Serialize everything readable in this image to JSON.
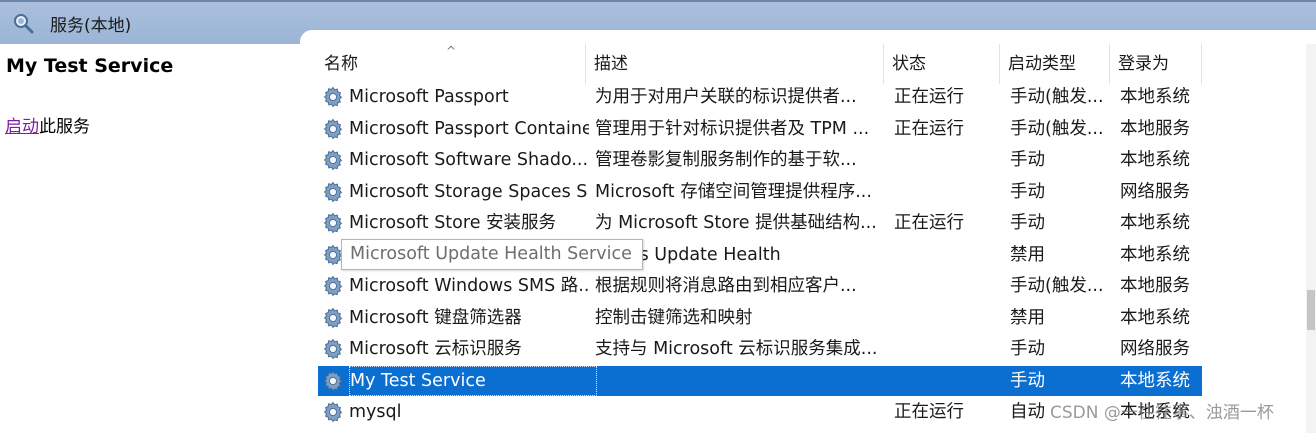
{
  "window": {
    "title": "服务(本地)",
    "icon": "services-magnifier-icon"
  },
  "left_pane": {
    "service_name": "My Test Service",
    "action_link": "启动",
    "action_suffix": "此服务"
  },
  "columns": {
    "name": "名称",
    "description": "描述",
    "status": "状态",
    "startup_type": "启动类型",
    "logon_as": "登录为",
    "sorted_column": "名称",
    "sort_direction": "ascending"
  },
  "rows": [
    {
      "name": "Microsoft Passport",
      "description": "为用于对用户关联的标识提供者...",
      "status": "正在运行",
      "startup_type": "手动(触发...",
      "logon_as": "本地系统"
    },
    {
      "name": "Microsoft Passport Container",
      "description": "管理用于针对标识提供者及 TPM ...",
      "status": "正在运行",
      "startup_type": "手动(触发...",
      "logon_as": "本地服务"
    },
    {
      "name": "Microsoft Software Shado...",
      "description": "管理卷影复制服务制作的基于软...",
      "status": "",
      "startup_type": "手动",
      "logon_as": "本地系统"
    },
    {
      "name": "Microsoft Storage Spaces S...",
      "description": "Microsoft 存储空间管理提供程序...",
      "status": "",
      "startup_type": "手动",
      "logon_as": "网络服务"
    },
    {
      "name": "Microsoft Store 安装服务",
      "description": "为 Microsoft Store 提供基础结构...",
      "status": "正在运行",
      "startup_type": "手动",
      "logon_as": "本地系统"
    },
    {
      "name": "Microsoft Update Health Service",
      "description": "ntains Update Health",
      "status": "",
      "startup_type": "禁用",
      "logon_as": "本地系统"
    },
    {
      "name": "Microsoft Windows SMS 路...",
      "description": "根据规则将消息路由到相应客户...",
      "status": "",
      "startup_type": "手动(触发...",
      "logon_as": "本地服务"
    },
    {
      "name": "Microsoft 键盘筛选器",
      "description": "控制击键筛选和映射",
      "status": "",
      "startup_type": "禁用",
      "logon_as": "本地系统"
    },
    {
      "name": "Microsoft 云标识服务",
      "description": "支持与 Microsoft 云标识服务集成...",
      "status": "",
      "startup_type": "手动",
      "logon_as": "网络服务"
    },
    {
      "name": "My Test Service",
      "description": "",
      "status": "",
      "startup_type": "手动",
      "logon_as": "本地系统",
      "selected": true
    },
    {
      "name": "mysql",
      "description": "",
      "status": "正在运行",
      "startup_type": "自动",
      "logon_as": "本地系统"
    }
  ],
  "tooltip": {
    "text": "Microsoft Update Health Service"
  },
  "watermark": {
    "text": "CSDN @一往往事、浊酒一杯"
  },
  "colors": {
    "selection": "#0a6fd1",
    "link": "#7a1fa2",
    "titlebar": "#a9bfdc"
  }
}
